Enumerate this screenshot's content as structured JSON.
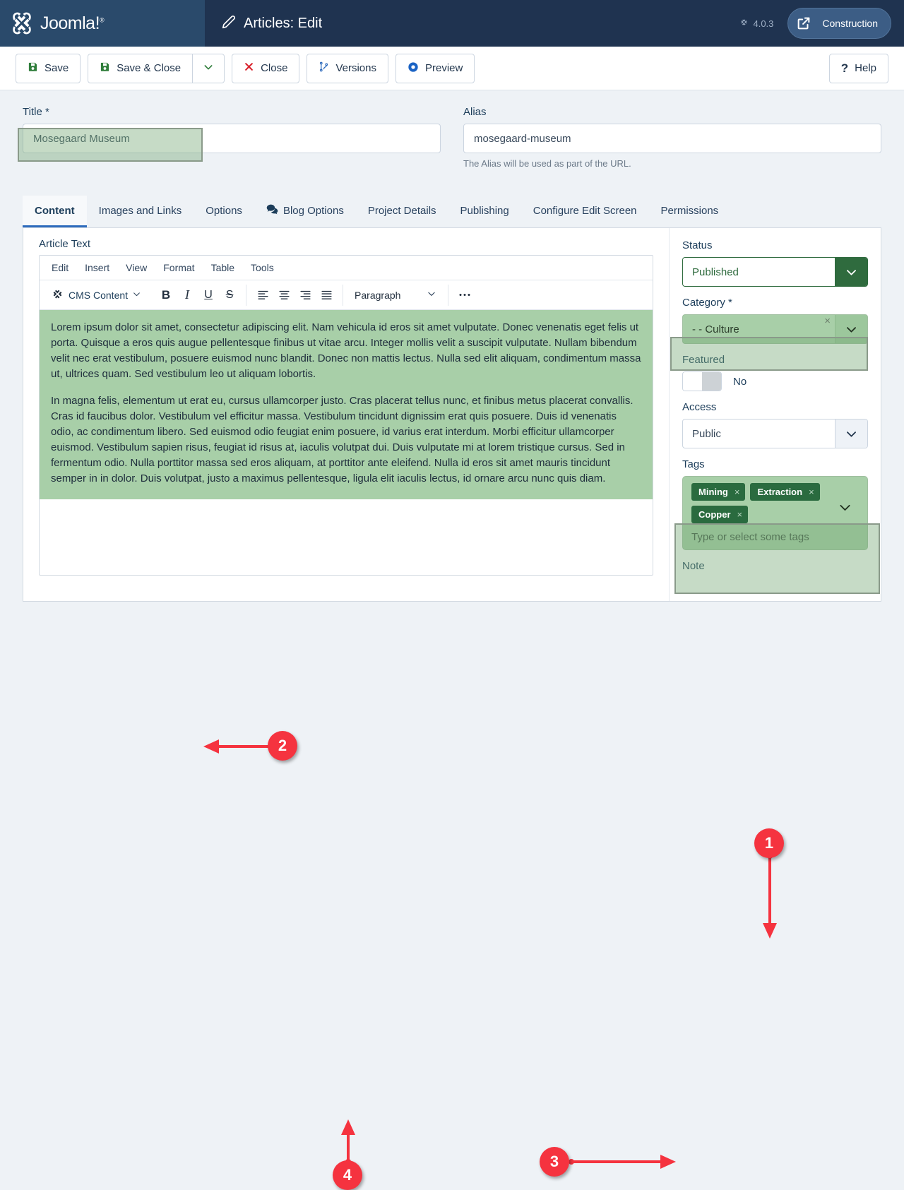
{
  "header": {
    "brand": "Joomla!",
    "brand_sup": "®",
    "page_title": "Articles: Edit",
    "version": "4.0.3",
    "site_button": "Construction"
  },
  "toolbar": {
    "save": "Save",
    "save_close": "Save & Close",
    "close": "Close",
    "versions": "Versions",
    "preview": "Preview",
    "help": "Help"
  },
  "fields": {
    "title_label": "Title *",
    "title_value": "Mosegaard Museum",
    "alias_label": "Alias",
    "alias_value": "mosegaard-museum",
    "alias_help": "The Alias will be used as part of the URL."
  },
  "tabs": [
    {
      "label": "Content",
      "active": true
    },
    {
      "label": "Images and Links",
      "active": false
    },
    {
      "label": "Options",
      "active": false
    },
    {
      "label": "Blog Options",
      "active": false,
      "icon": "comments-icon"
    },
    {
      "label": "Project Details",
      "active": false
    },
    {
      "label": "Publishing",
      "active": false
    },
    {
      "label": "Configure Edit Screen",
      "active": false
    },
    {
      "label": "Permissions",
      "active": false
    }
  ],
  "editor": {
    "label": "Article Text",
    "menus": [
      "Edit",
      "Insert",
      "View",
      "Format",
      "Table",
      "Tools"
    ],
    "cms_content": "CMS Content",
    "format_select": "Paragraph",
    "buttons": [
      "bold",
      "italic",
      "underline",
      "strikethrough",
      "align-left",
      "align-center",
      "align-right",
      "align-justify",
      "more"
    ],
    "paragraphs": [
      "Lorem ipsum dolor sit amet, consectetur adipiscing elit. Nam vehicula id eros sit amet vulputate. Donec venenatis eget felis ut porta. Quisque a eros quis augue pellentesque finibus ut vitae arcu. Integer mollis velit a suscipit vulputate. Nullam bibendum velit nec erat vestibulum, posuere euismod nunc blandit. Donec non mattis lectus. Nulla sed elit aliquam, condimentum massa ut, ultrices quam. Sed vestibulum leo ut aliquam lobortis.",
      "In magna felis, elementum ut erat eu, cursus ullamcorper justo. Cras placerat tellus nunc, et finibus metus placerat convallis. Cras id faucibus dolor. Vestibulum vel efficitur massa. Vestibulum tincidunt dignissim erat quis posuere. Duis id venenatis odio, ac condimentum libero. Sed euismod odio feugiat enim posuere, id varius erat interdum. Morbi efficitur ullamcorper euismod. Vestibulum sapien risus, feugiat id risus at, iaculis volutpat dui. Duis vulputate mi at lorem tristique cursus. Sed in fermentum odio. Nulla porttitor massa sed eros aliquam, at porttitor ante eleifend. Nulla id eros sit amet mauris tincidunt semper in in dolor. Duis volutpat, justo a maximus pellentesque, ligula elit iaculis lectus, id ornare arcu nunc quis diam."
    ]
  },
  "sidebar": {
    "status_label": "Status",
    "status_value": "Published",
    "category_label": "Category *",
    "category_value": "- - Culture",
    "category_clear": "×",
    "featured_label": "Featured",
    "featured_value": "No",
    "access_label": "Access",
    "access_value": "Public",
    "tags_label": "Tags",
    "tags": [
      "Mining",
      "Extraction",
      "Copper"
    ],
    "tag_remove": "×",
    "tags_placeholder": "Type or select some tags",
    "note_label": "Note"
  },
  "annotations": [
    {
      "number": "1",
      "target": "category-field"
    },
    {
      "number": "2",
      "target": "title-field"
    },
    {
      "number": "3",
      "target": "tags-field"
    },
    {
      "number": "4",
      "target": "article-text-body"
    }
  ],
  "colors": {
    "brand_dark": "#1f3350",
    "brand_mid": "#2a4a6b",
    "accent_blue": "#2e6bbd",
    "green_highlight": "#a8cfa8",
    "green_dark": "#2f6b3e",
    "annotation_red": "#f5333f"
  }
}
